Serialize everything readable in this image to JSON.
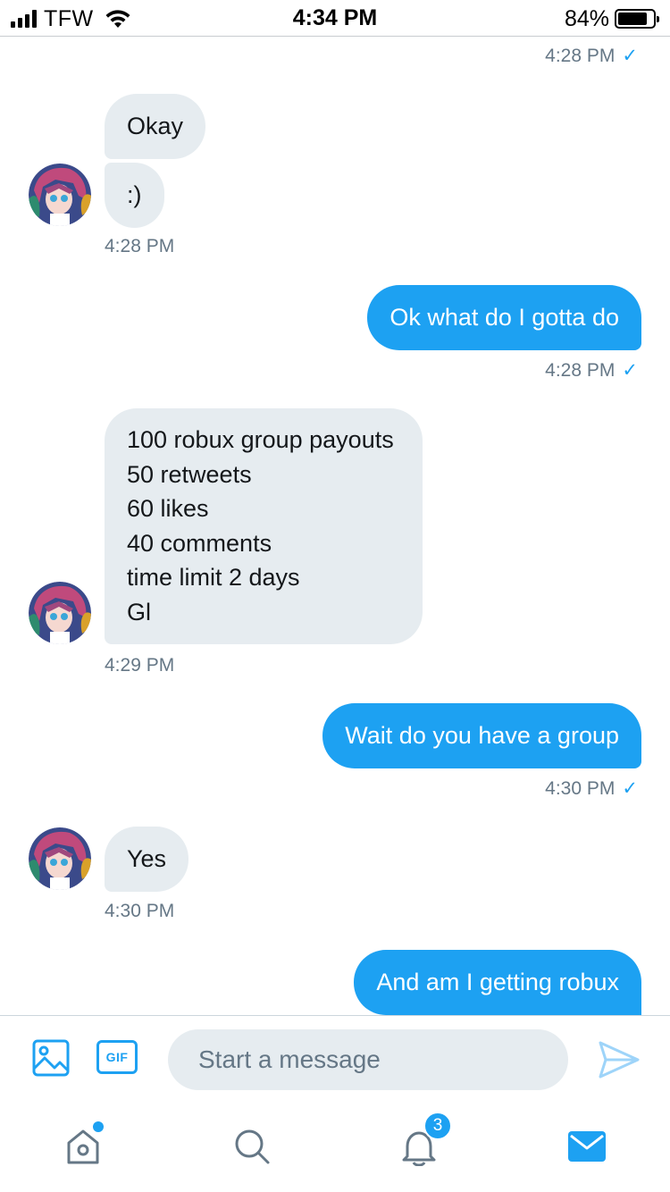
{
  "status_bar": {
    "carrier": "TFW",
    "time": "4:34 PM",
    "battery_percent": "84%",
    "battery_level": 0.84,
    "signal_bars": 4,
    "wifi": true
  },
  "conversation": {
    "timestamps": {
      "top": "4:28 PM",
      "after_okay": "4:28 PM",
      "after_ok_what": "4:28 PM",
      "after_list": "4:29 PM",
      "after_wait": "4:30 PM",
      "after_yes": "4:30 PM"
    },
    "read_check": "✓",
    "messages": {
      "okay": "Okay",
      "smile": ":)",
      "ok_what": "Ok what do I gotta do",
      "list_lines": [
        "100 robux group payouts",
        "50 retweets",
        "60 likes",
        "40 comments",
        "time limit 2 days",
        "Gl"
      ],
      "wait": "Wait do you have a group",
      "yes": "Yes",
      "and_am_i": "And am I getting robux"
    }
  },
  "compose": {
    "placeholder": "Start a message",
    "gif_label": "GIF",
    "icons": [
      "image-icon",
      "gif-icon",
      "send-icon"
    ]
  },
  "tabbar": {
    "notifications_badge": "3",
    "icons": [
      "home-icon",
      "search-icon",
      "bell-icon",
      "mail-icon"
    ],
    "accent_color": "#1da1f2"
  }
}
